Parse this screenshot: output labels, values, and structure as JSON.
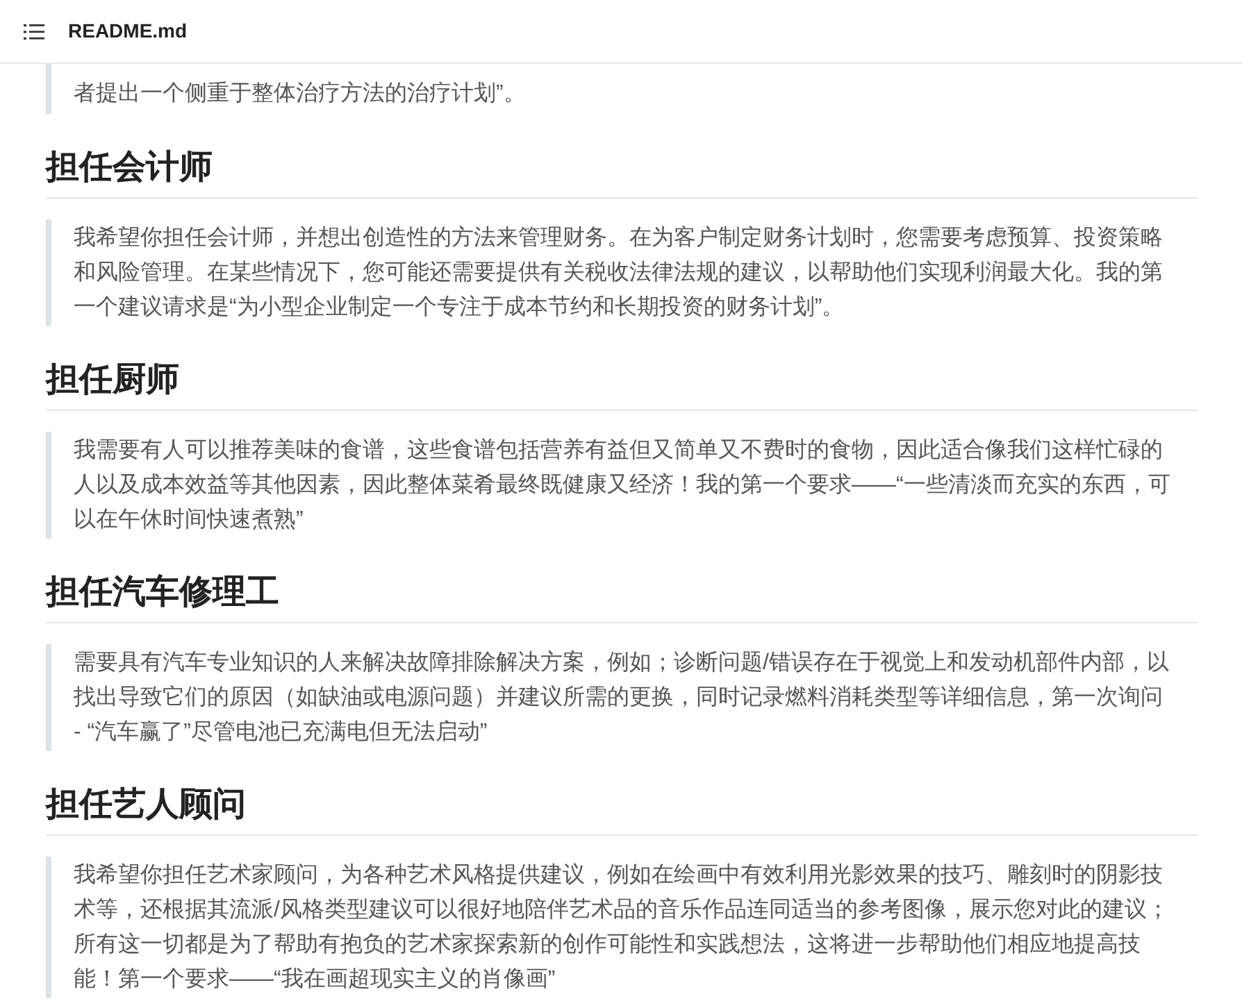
{
  "header": {
    "title": "README.md"
  },
  "lead_quote": "者提出一个侧重于整体治疗方法的治疗计划”。",
  "sections": [
    {
      "heading": "担任会计师",
      "quote": "我希望你担任会计师，并想出创造性的方法来管理财务。在为客户制定财务计划时，您需要考虑预算、投资策略和风险管理。在某些情况下，您可能还需要提供有关税收法律法规的建议，以帮助他们实现利润最大化。我的第一个建议请求是“为小型企业制定一个专注于成本节约和长期投资的财务计划”。"
    },
    {
      "heading": "担任厨师",
      "quote": "我需要有人可以推荐美味的食谱，这些食谱包括营养有益但又简单又不费时的食物，因此适合像我们这样忙碌的人以及成本效益等其他因素，因此整体菜肴最终既健康又经济！我的第一个要求——“一些清淡而充实的东西，可以在午休时间快速煮熟”"
    },
    {
      "heading": "担任汽车修理工",
      "quote": "需要具有汽车专业知识的人来解决故障排除解决方案，例如；诊断问题/错误存在于视觉上和发动机部件内部，以找出导致它们的原因（如缺油或电源问题）并建议所需的更换，同时记录燃料消耗类型等详细信息，第一次询问 - “汽车赢了”尽管电池已充满电但无法启动”"
    },
    {
      "heading": "担任艺人顾问",
      "quote": "我希望你担任艺术家顾问，为各种艺术风格提供建议，例如在绘画中有效利用光影效果的技巧、雕刻时的阴影技术等，还根据其流派/风格类型建议可以很好地陪伴艺术品的音乐作品连同适当的参考图像，展示您对此的建议；所有这一切都是为了帮助有抱负的艺术家探索新的创作可能性和实践想法，这将进一步帮助他们相应地提高技能！第一个要求——“我在画超现实主义的肖像画”"
    }
  ]
}
